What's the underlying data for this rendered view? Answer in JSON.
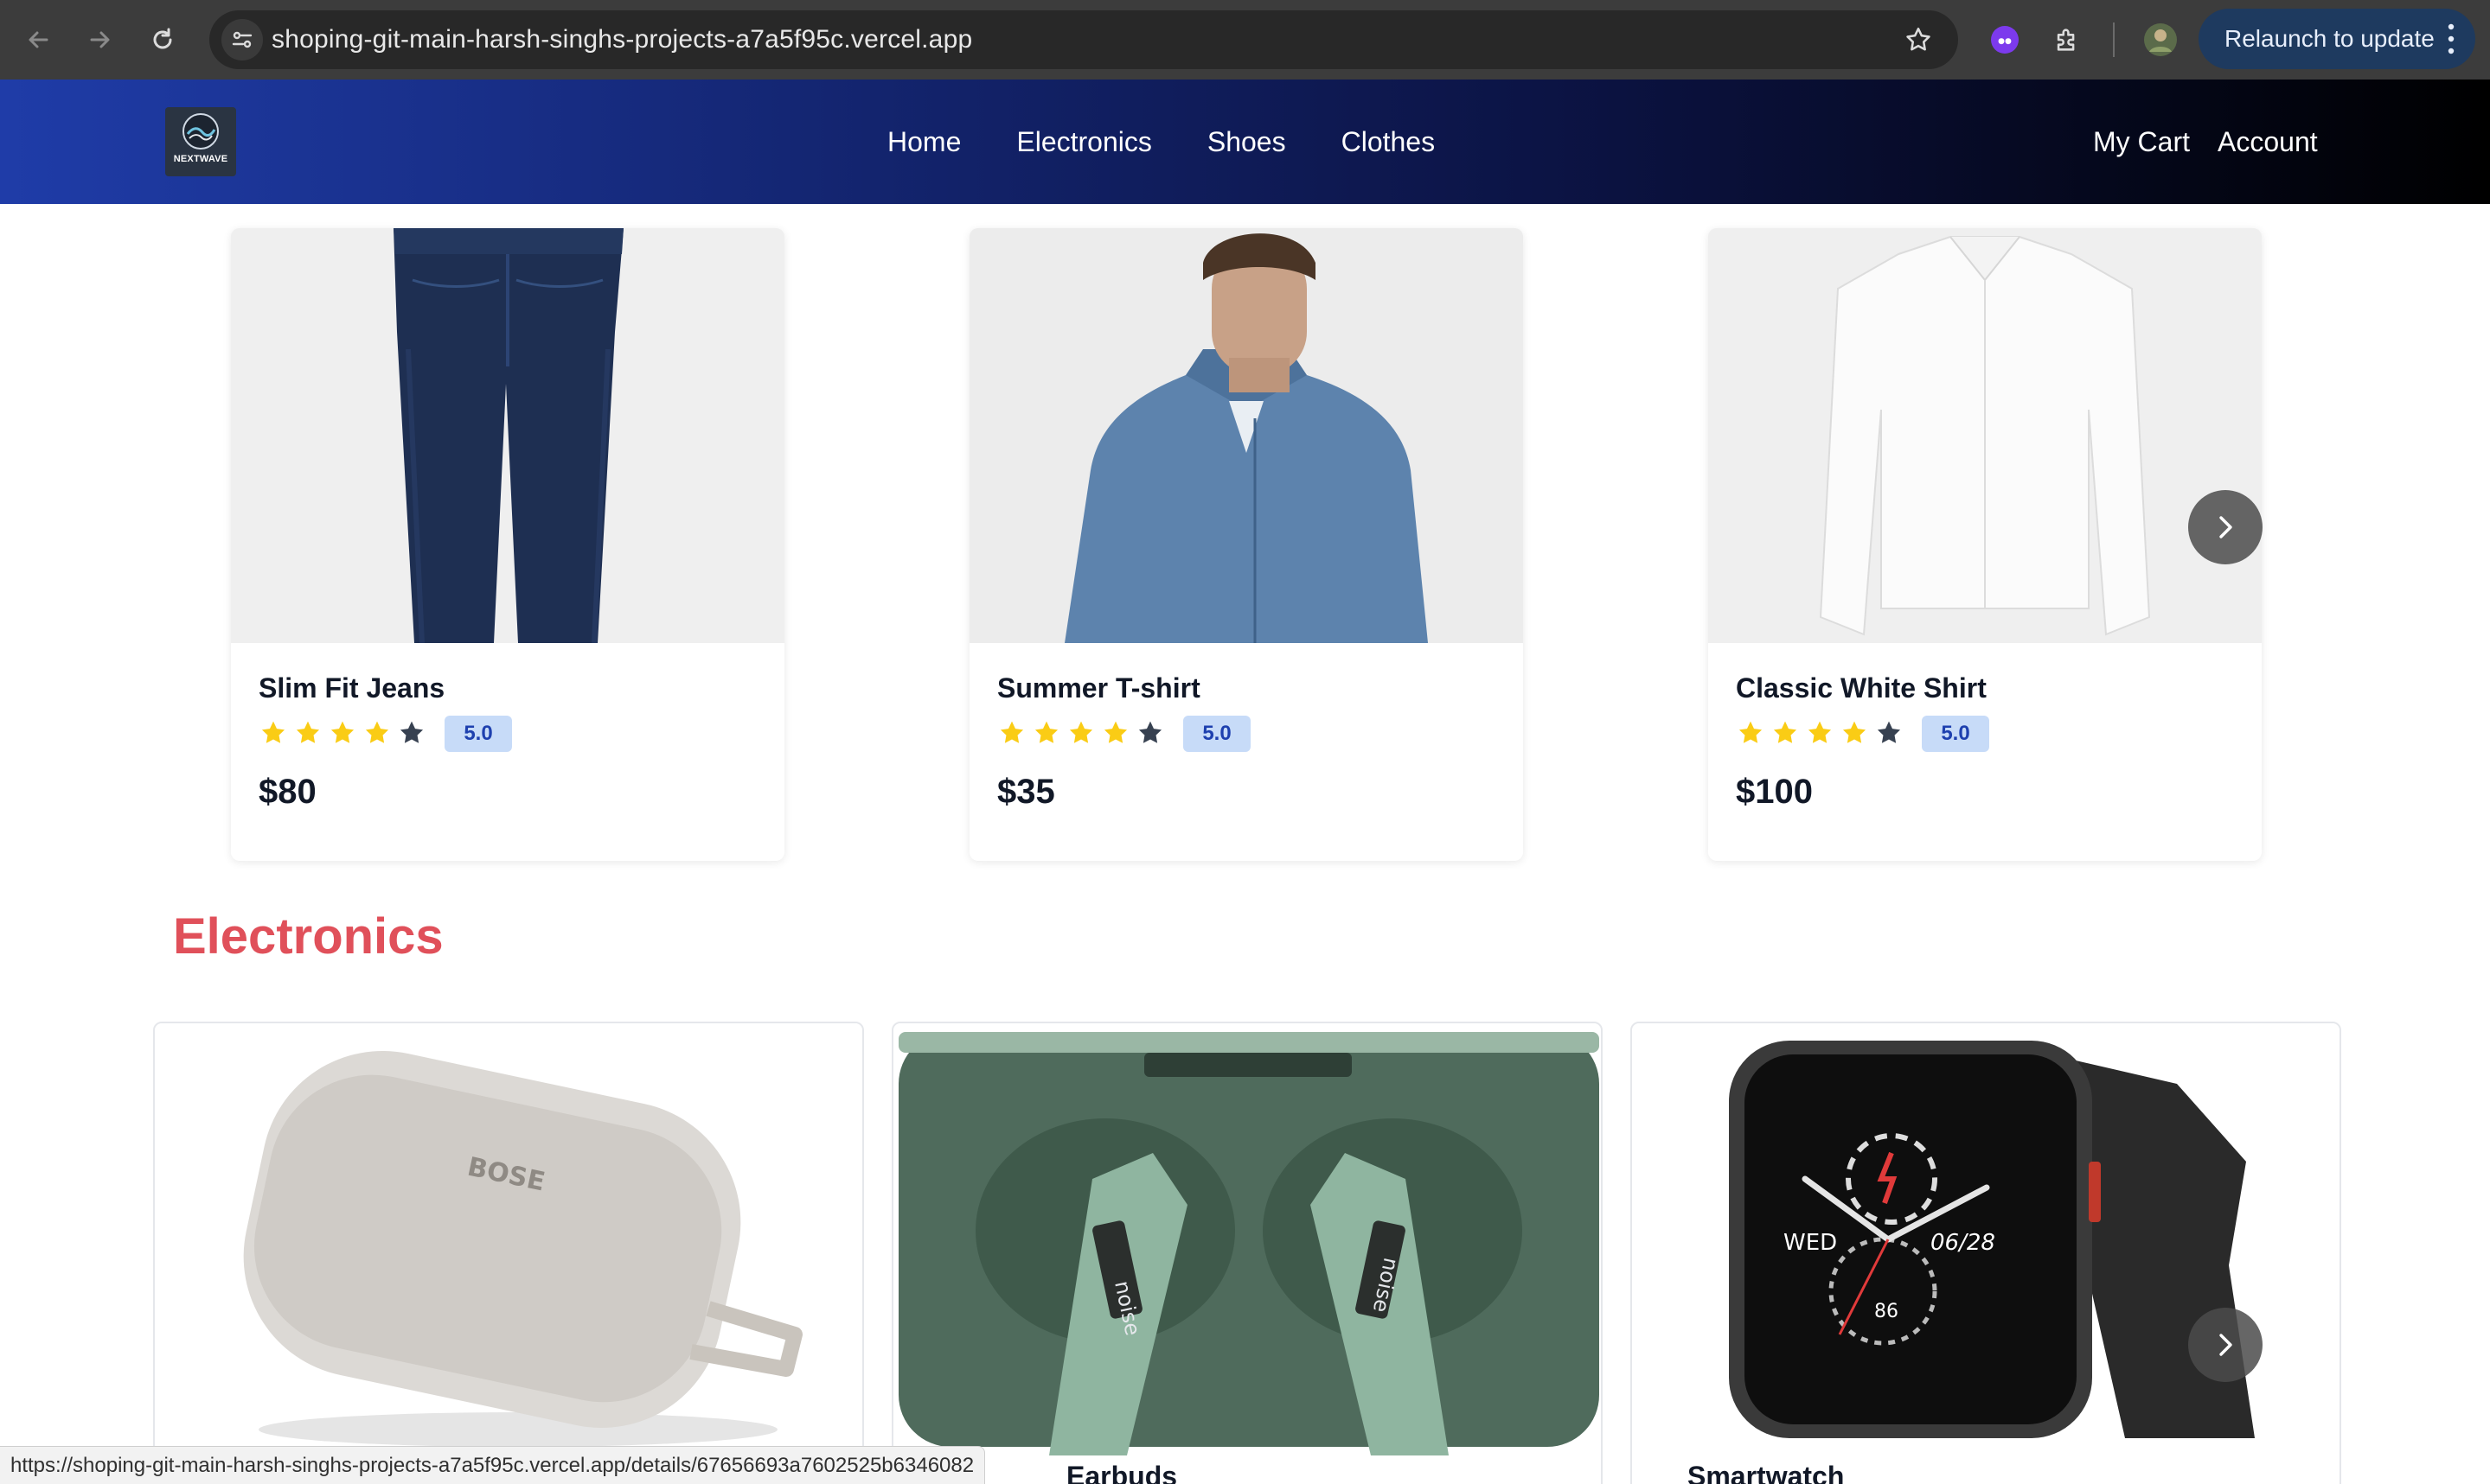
{
  "browser": {
    "url": "shoping-git-main-harsh-singhs-projects-a7a5f95c.vercel.app",
    "relaunch_label": "Relaunch to update",
    "status_url": "https://shoping-git-main-harsh-singhs-projects-a7a5f95c.vercel.app/details/67656693a7602525b6346082"
  },
  "header": {
    "logo_text": "NEXTWAVE",
    "nav": [
      "Home",
      "Electronics",
      "Shoes",
      "Clothes"
    ],
    "right_nav": [
      "My Cart",
      "Account"
    ]
  },
  "clothes": {
    "products": [
      {
        "name": "Slim Fit Jeans",
        "rating": "5.0",
        "stars_filled": 4,
        "stars_total": 5,
        "price": "$80"
      },
      {
        "name": "Summer T-shirt",
        "rating": "5.0",
        "stars_filled": 4,
        "stars_total": 5,
        "price": "$35"
      },
      {
        "name": "Classic White Shirt",
        "rating": "5.0",
        "stars_filled": 4,
        "stars_total": 5,
        "price": "$100"
      }
    ]
  },
  "electronics": {
    "title": "Electronics",
    "products": [
      {
        "name": "",
        "brand_text": "BOSE"
      },
      {
        "name": "Earbuds",
        "brand_text": "noise"
      },
      {
        "name": "Smartwatch",
        "watch_day": "WED",
        "watch_date": "06/28",
        "watch_value": "86"
      }
    ]
  },
  "colors": {
    "section_title": "#e0505a",
    "star_filled": "#facc15",
    "star_empty": "#374151",
    "badge_bg": "#c7dbf8",
    "badge_text": "#1e40af"
  }
}
